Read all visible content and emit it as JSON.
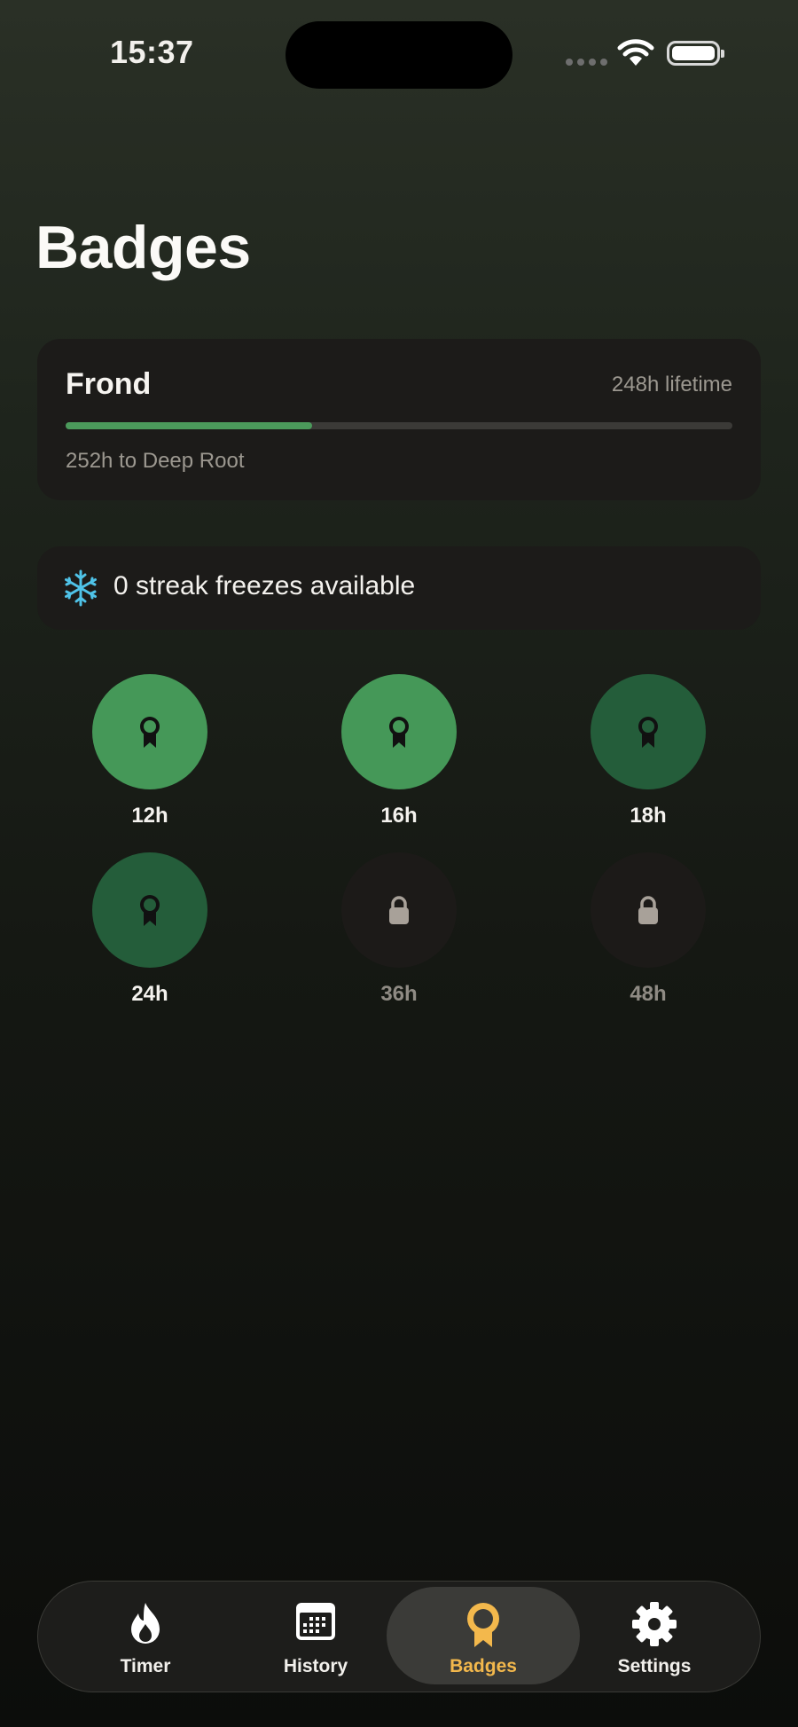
{
  "status_bar": {
    "time": "15:37"
  },
  "page": {
    "title": "Badges"
  },
  "rank_card": {
    "rank_name": "Frond",
    "lifetime_text": "248h lifetime",
    "progress_fraction": 0.37,
    "next_rank_text": "252h to Deep Root"
  },
  "freeze_card": {
    "icon": "snowflake-icon",
    "text": "0 streak freezes available"
  },
  "badges": [
    {
      "label": "12h",
      "state": "earned",
      "icon": "award-ribbon-icon"
    },
    {
      "label": "16h",
      "state": "earned",
      "icon": "award-ribbon-icon"
    },
    {
      "label": "18h",
      "state": "earned",
      "icon": "award-ribbon-icon"
    },
    {
      "label": "24h",
      "state": "earned",
      "icon": "award-ribbon-icon"
    },
    {
      "label": "36h",
      "state": "locked",
      "icon": "lock-icon"
    },
    {
      "label": "48h",
      "state": "locked",
      "icon": "lock-icon"
    }
  ],
  "tab_bar": {
    "tabs": [
      {
        "label": "Timer",
        "icon": "flame-icon",
        "active": false
      },
      {
        "label": "History",
        "icon": "calendar-icon",
        "active": false
      },
      {
        "label": "Badges",
        "icon": "award-icon",
        "active": true
      },
      {
        "label": "Settings",
        "icon": "gear-icon",
        "active": false
      }
    ]
  },
  "colors": {
    "accent_green": "#4b9a5b",
    "badge_earned_light": "#459858",
    "badge_earned_dark": "#245d3a",
    "tab_active": "#f3b84c",
    "snowflake": "#4fc3e8"
  }
}
